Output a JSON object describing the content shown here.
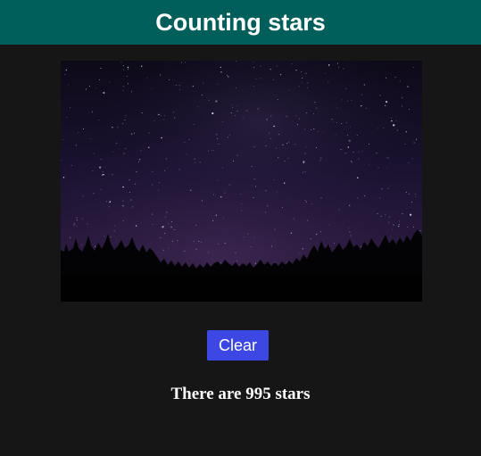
{
  "header": {
    "title": "Counting stars",
    "background_color": "#005f5a"
  },
  "photo": {
    "subject": "night-sky-with-tree-silhouettes"
  },
  "controls": {
    "clear_label": "Clear",
    "button_color": "#3d47e3"
  },
  "result": {
    "count_text": "There are 995 stars"
  },
  "colors": {
    "page_background": "#161616",
    "text": "#ffffff"
  }
}
